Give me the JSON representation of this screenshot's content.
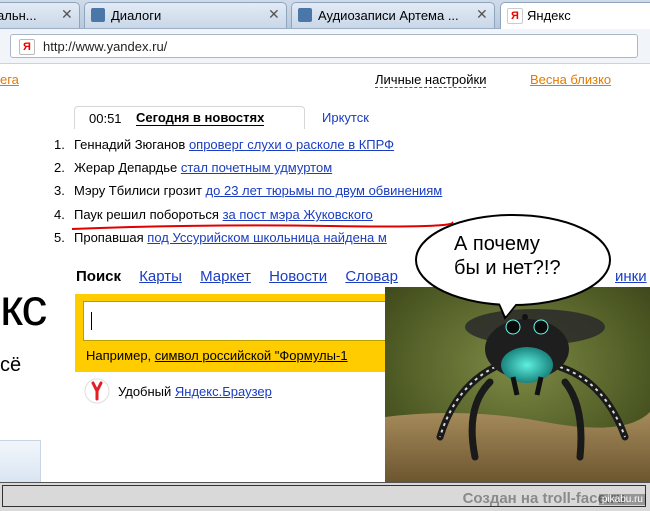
{
  "tabs": [
    {
      "title": "альн...",
      "favicon": "generic"
    },
    {
      "title": "Диалоги",
      "favicon": "vk"
    },
    {
      "title": "Аудиозаписи Артема ...",
      "favicon": "vk"
    },
    {
      "title": "Яндекс",
      "favicon": "yandex"
    }
  ],
  "tab_close_glyph": "✕",
  "address_bar": {
    "url": "http://www.yandex.ru/",
    "favicon_letter": "Я"
  },
  "header": {
    "left_cut": "ега",
    "personal_settings": "Личные настройки",
    "spring_link": "Весна близко"
  },
  "news": {
    "time": "00:51",
    "today_tab": "Сегодня в новостях",
    "region_tab": "Иркутск",
    "items": [
      {
        "num": "1.",
        "lead": "Геннадий Зюганов ",
        "link": "опроверг слухи о расколе в КПРФ"
      },
      {
        "num": "2.",
        "lead": "Жерар Депардье ",
        "link": "стал почетным удмуртом"
      },
      {
        "num": "3.",
        "lead": "Мэру Тбилиси грозит ",
        "link": "до 23 лет тюрьмы по двум обвинениям"
      },
      {
        "num": "4.",
        "lead": "Паук решил побороться ",
        "link": "за пост мэра Жуковского"
      },
      {
        "num": "5.",
        "lead": "Пропавшая ",
        "link": "под Уссурийском школьница найдена м"
      }
    ]
  },
  "services": {
    "current": "Поиск",
    "items": [
      "Карты",
      "Маркет",
      "Новости",
      "Словар"
    ],
    "right_cut": "инки"
  },
  "search": {
    "example_prefix": "Например, ",
    "example_link": "символ российской \"Формулы-1"
  },
  "logo_fragment": "кс",
  "logo_subtitle": "сё",
  "browser_promo": {
    "text": "Удобный ",
    "link": "Яндекс.Браузер"
  },
  "bubble_text": "А почему\nбы и нет?!?",
  "footer": {
    "watermark": "Создан на troll-face.ru",
    "pikabu": "pikabu.ru"
  },
  "colors": {
    "link": "#1a3dc1",
    "yandex_yellow": "#ffcc00",
    "underline_red": "#e00000",
    "spring_orange": "#e07b00"
  }
}
